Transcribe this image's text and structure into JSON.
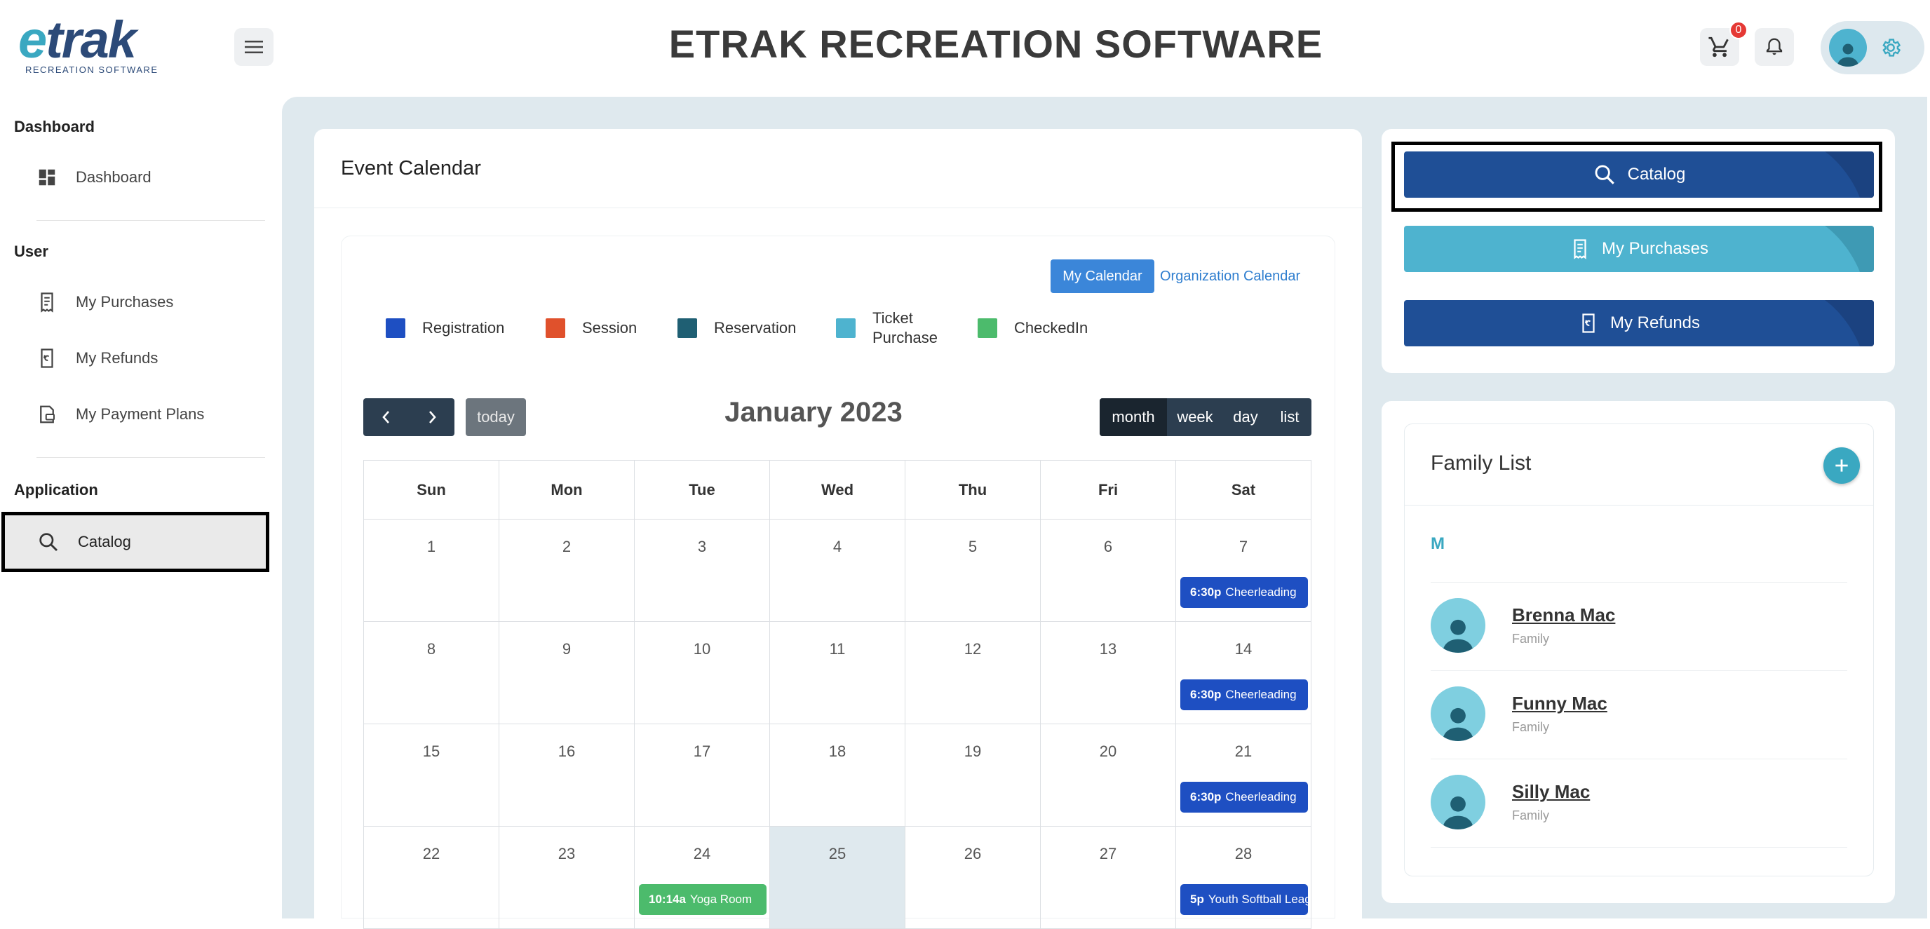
{
  "header": {
    "logo_word": "trak",
    "logo_letter": "e",
    "logo_sub": "RECREATION SOFTWARE",
    "title": "ETRAK RECREATION SOFTWARE",
    "cart_count": "0"
  },
  "sidebar": {
    "sections": [
      {
        "heading": "Dashboard",
        "items": [
          {
            "label": "Dashboard",
            "icon": "dashboard-icon"
          }
        ]
      },
      {
        "heading": "User",
        "items": [
          {
            "label": "My Purchases",
            "icon": "receipt-icon"
          },
          {
            "label": "My Refunds",
            "icon": "refund-icon"
          },
          {
            "label": "My Payment Plans",
            "icon": "payment-plan-icon"
          }
        ]
      },
      {
        "heading": "Application",
        "items": [
          {
            "label": "Catalog",
            "icon": "search-icon",
            "selected": true
          }
        ]
      }
    ]
  },
  "calendar": {
    "card_title": "Event Calendar",
    "my_calendar": "My Calendar",
    "org_calendar": "Organization Calendar",
    "legend": [
      {
        "label": "Registration",
        "color": "#1e4fc2"
      },
      {
        "label": "Session",
        "color": "#e0512c"
      },
      {
        "label": "Reservation",
        "color": "#1f5f73"
      },
      {
        "label": "Ticket Purchase",
        "color": "#4eb3cf"
      },
      {
        "label": "CheckedIn",
        "color": "#4cbb6c"
      }
    ],
    "today_label": "today",
    "month_title": "January 2023",
    "views": [
      "month",
      "week",
      "day",
      "list"
    ],
    "active_view": "month",
    "weekdays": [
      "Sun",
      "Mon",
      "Tue",
      "Wed",
      "Thu",
      "Fri",
      "Sat"
    ],
    "weeks": [
      [
        "1",
        "2",
        "3",
        "4",
        "5",
        "6",
        "7"
      ],
      [
        "8",
        "9",
        "10",
        "11",
        "12",
        "13",
        "14"
      ],
      [
        "15",
        "16",
        "17",
        "18",
        "19",
        "20",
        "21"
      ],
      [
        "22",
        "23",
        "24",
        "25",
        "26",
        "27",
        "28"
      ]
    ],
    "today_date": "25",
    "events": [
      {
        "day": "7",
        "time": "6:30p",
        "title": "Cheerleading",
        "color": "#1e4fc2"
      },
      {
        "day": "14",
        "time": "6:30p",
        "title": "Cheerleading",
        "color": "#1e4fc2"
      },
      {
        "day": "21",
        "time": "6:30p",
        "title": "Cheerleading",
        "color": "#1e4fc2"
      },
      {
        "day": "24",
        "time": "10:14a",
        "title": "Yoga Room",
        "color": "#4cbb6c"
      },
      {
        "day": "28",
        "time": "5p",
        "title": "Youth Softball League",
        "color": "#1e4fc2"
      }
    ]
  },
  "quick_actions": {
    "catalog": "Catalog",
    "purchases": "My Purchases",
    "refunds": "My Refunds"
  },
  "family": {
    "title": "Family List",
    "letter": "M",
    "members": [
      {
        "name": "Brenna Mac",
        "role": "Family"
      },
      {
        "name": "Funny Mac",
        "role": "Family"
      },
      {
        "name": "Silly Mac",
        "role": "Family"
      }
    ]
  }
}
